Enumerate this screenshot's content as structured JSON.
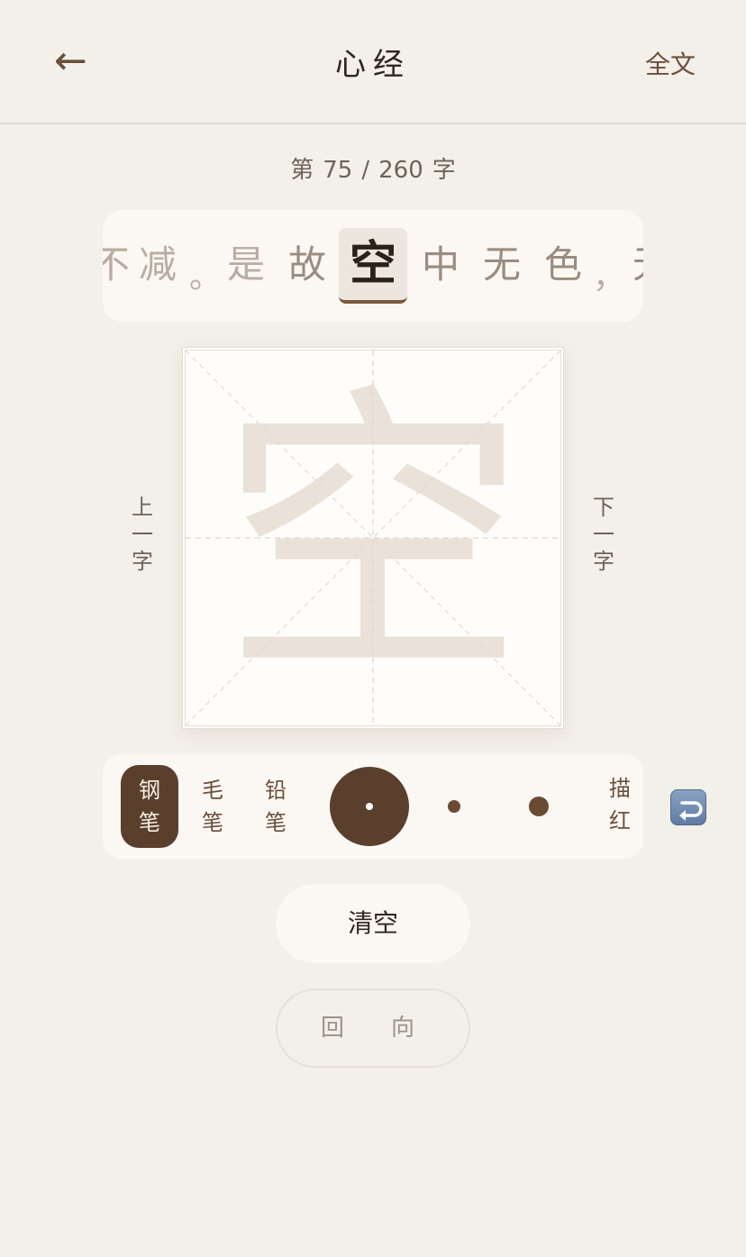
{
  "header": {
    "back_icon": "←",
    "title": "心经",
    "fulltext_label": "全文"
  },
  "progress": {
    "prefix": "第",
    "current": "75",
    "separator": "/",
    "total": "260",
    "suffix": "字"
  },
  "strip": {
    "chars": [
      "不",
      "减",
      "。",
      "是",
      "故",
      "空",
      "中",
      "无",
      "色",
      "，",
      "无"
    ],
    "current": "空"
  },
  "nav": {
    "prev_label": [
      "上",
      "一",
      "字"
    ],
    "next_label": [
      "下",
      "一",
      "字"
    ]
  },
  "canvas": {
    "guide_char": "空"
  },
  "toolbar": {
    "brushes": [
      {
        "label": [
          "钢",
          "笔"
        ],
        "active": true
      },
      {
        "label": [
          "毛",
          "笔"
        ],
        "active": false
      },
      {
        "label": [
          "铅",
          "笔"
        ],
        "active": false
      }
    ],
    "sizes": [
      "small",
      "medium",
      "large"
    ],
    "selected_size": "small",
    "trace_label": [
      "描",
      "红"
    ],
    "undo_icon": "undo-icon"
  },
  "actions": {
    "clear_label": "清空",
    "direction_labels": [
      "回",
      "向"
    ]
  },
  "colors": {
    "background": "#f3efe9",
    "accent": "#5a3f2d",
    "guide_char": "#eae1d8"
  }
}
